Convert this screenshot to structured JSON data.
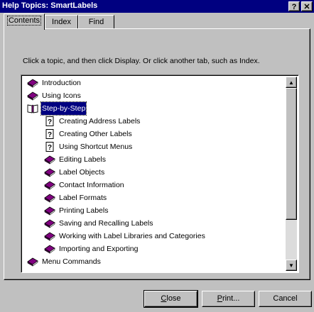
{
  "window": {
    "title": "Help Topics: SmartLabels",
    "help_btn": "?",
    "close_btn": "✕"
  },
  "tabs": [
    {
      "label": "Contents",
      "active": true
    },
    {
      "label": "Index",
      "active": false
    },
    {
      "label": "Find",
      "active": false
    }
  ],
  "instruction": "Click a topic, and then click Display. Or click another tab, such as Index.",
  "tree": [
    {
      "label": "Introduction",
      "icon": "closed-book-icon",
      "indent": 0
    },
    {
      "label": "Using Icons",
      "icon": "closed-book-icon",
      "indent": 0
    },
    {
      "label": "Step-by-Step",
      "icon": "open-book-icon",
      "indent": 0,
      "selected": true
    },
    {
      "label": "Creating Address Labels",
      "icon": "help-page-icon",
      "indent": 1
    },
    {
      "label": "Creating Other Labels",
      "icon": "help-page-icon",
      "indent": 1
    },
    {
      "label": "Using Shortcut Menus",
      "icon": "help-page-icon",
      "indent": 1
    },
    {
      "label": "Editing Labels",
      "icon": "closed-book-icon",
      "indent": 1
    },
    {
      "label": "Label Objects",
      "icon": "closed-book-icon",
      "indent": 1
    },
    {
      "label": "Contact Information",
      "icon": "closed-book-icon",
      "indent": 1
    },
    {
      "label": "Label Formats",
      "icon": "closed-book-icon",
      "indent": 1
    },
    {
      "label": "Printing Labels",
      "icon": "closed-book-icon",
      "indent": 1
    },
    {
      "label": "Saving and Recalling Labels",
      "icon": "closed-book-icon",
      "indent": 1
    },
    {
      "label": "Working with Label Libraries and Categories",
      "icon": "closed-book-icon",
      "indent": 1
    },
    {
      "label": "Importing and Exporting",
      "icon": "closed-book-icon",
      "indent": 1
    },
    {
      "label": "Menu Commands",
      "icon": "closed-book-icon",
      "indent": 0
    }
  ],
  "buttons": {
    "close": {
      "label": "Close",
      "underline_index": 0
    },
    "print": {
      "label": "Print...",
      "underline_index": 0
    },
    "cancel": {
      "label": "Cancel"
    }
  },
  "scrollbar": {
    "up_icon": "▲",
    "down_icon": "▼"
  },
  "colors": {
    "title_bar": "#000080",
    "selection": "#000080",
    "book_purple": "#800080",
    "face": "#c0c0c0"
  }
}
